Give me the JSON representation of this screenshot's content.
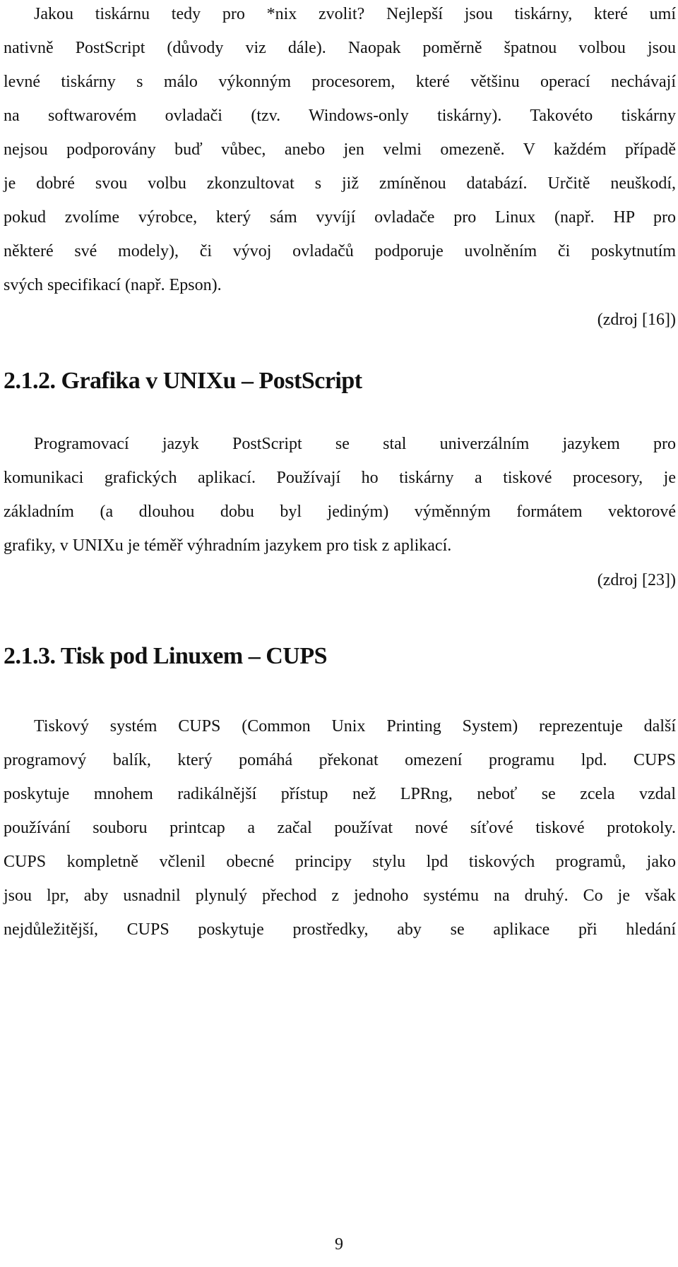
{
  "page": {
    "paragraph1": {
      "lines": [
        "Jakou tiskárnu tedy pro *nix zvolit? Nejlepší jsou tiskárny, které umí",
        "nativně PostScript (důvody viz dále). Naopak poměrně špatnou volbou jsou",
        "levné tiskárny s málo výkonným procesorem, které většinu operací nechávají",
        "na softwarovém ovladači (tzv. Windows-only tiskárny). Takovéto tiskárny",
        "nejsou podporovány buď vůbec, anebo jen velmi omezeně. V každém případě",
        "je dobré svou volbu zkonzultovat s již zmíněnou databází. Určitě neuškodí,",
        "pokud zvolíme výrobce, který sám vyvíjí ovladače pro Linux (např. HP pro",
        "některé své modely), či vývoj ovladačů podporuje uvolněním či poskytnutím",
        "svých specifikací (např. Epson)."
      ],
      "source": "(zdroj [16])"
    },
    "section_212": {
      "heading": "2.1.2. Grafika v UNIXu – PostScript",
      "lines": [
        "Programovací jazyk PostScript se stal univerzálním jazykem pro",
        "komunikaci grafických aplikací. Používají ho tiskárny a tiskové procesory, je",
        "základním (a dlouhou dobu byl jediným) výměnným formátem vektorové",
        "grafiky, v UNIXu je téměř výhradním jazykem pro tisk z aplikací."
      ],
      "source": "(zdroj [23])"
    },
    "section_213": {
      "heading": "2.1.3. Tisk pod Linuxem – CUPS",
      "lines": [
        "Tiskový systém CUPS (Common Unix Printing System) reprezentuje další",
        "programový balík, který pomáhá překonat omezení programu lpd. CUPS",
        "poskytuje mnohem radikálnější přístup než LPRng, neboť se zcela vzdal",
        "používání souboru printcap a začal používat nové síťové tiskové protokoly.",
        "CUPS kompletně včlenil obecné principy stylu lpd tiskových programů, jako",
        "jsou lpr, aby usnadnil plynulý přechod z jednoho systému na druhý. Co je však",
        "nejdůležitější, CUPS poskytuje prostředky, aby se aplikace při hledání"
      ]
    },
    "page_number": "9"
  }
}
